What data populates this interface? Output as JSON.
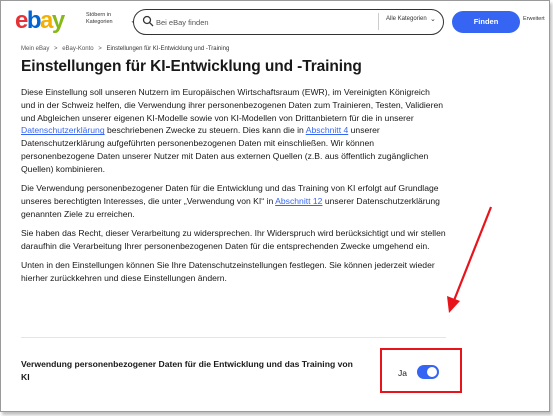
{
  "header": {
    "logo": {
      "e": "e",
      "b": "b",
      "a": "a",
      "y": "y"
    },
    "category_button_label": "Stöbern in Kategorien",
    "search_placeholder": "Bei eBay finden",
    "search_category": "Alle Kategorien",
    "find_button": "Finden",
    "advanced_label": "Erweitert"
  },
  "breadcrumb": [
    "Mein eBay",
    "eBay-Konto",
    "Einstellungen für KI-Entwicklung und -Training"
  ],
  "breadcrumb_separator": ">",
  "page_title": "Einstellungen für KI-Entwicklung und -Training",
  "paragraphs": {
    "p1_a": "Diese Einstellung soll unseren Nutzern im Europäischen Wirtschaftsraum (EWR), im Vereinigten Königreich und in der Schweiz helfen, die Verwendung ihrer personenbezogenen Daten zum Trainieren, Testen, Validieren und Abgleichen unserer eigenen KI-Modelle sowie von KI-Modellen von Drittanbietern für die in unserer ",
    "p1_link1": "Datenschutzerklärung",
    "p1_b": " beschriebenen Zwecke zu steuern. Dies kann die in ",
    "p1_link2": "Abschnitt 4",
    "p1_c": " unserer Datenschutzerklärung aufgeführten personenbezogenen Daten mit einschließen. Wir können personenbezogene Daten unserer Nutzer mit Daten aus externen Quellen (z.B. aus öffentlich zugänglichen Quellen) kombinieren.",
    "p2_a": "Die Verwendung personenbezogener Daten für die Entwicklung und das Training von KI erfolgt auf Grundlage unseres berechtigten Interesses, die unter „Verwendung von KI“ in ",
    "p2_link": "Abschnitt 12",
    "p2_b": " unserer Datenschutzerklärung genannten Ziele zu erreichen.",
    "p3": "Sie haben das Recht, dieser Verarbeitung zu widersprechen. Ihr Widerspruch wird berücksichtigt und wir stellen daraufhin die Verarbeitung Ihrer personenbezogenen Daten für die entsprechenden Zwecke umgehend ein.",
    "p4": "Unten in den Einstellungen können Sie Ihre Datenschutzeinstellungen festlegen. Sie können jederzeit wieder hierher zurückkehren und diese Einstellungen ändern."
  },
  "setting": {
    "label": "Verwendung personenbezogener Daten für die Entwicklung und das Training von KI",
    "state_label": "Ja",
    "enabled": true
  },
  "colors": {
    "accent": "#3665f3",
    "annotation": "#e8141b"
  }
}
